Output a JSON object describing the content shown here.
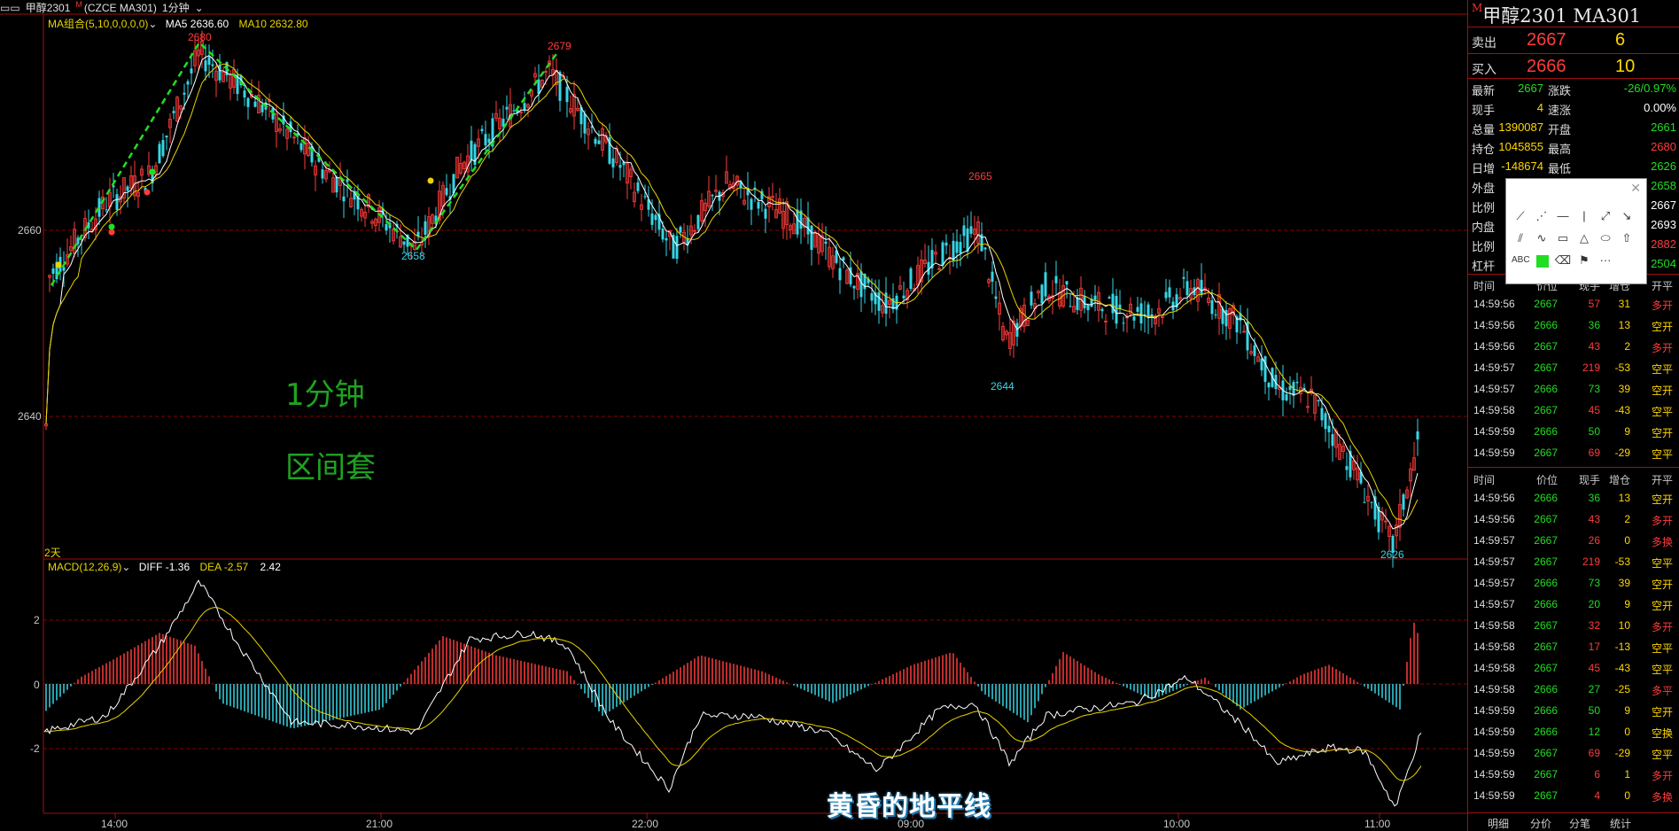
{
  "topbar": {
    "symbol": "甲醇2301",
    "code": "(CZCE MA301)",
    "period": "1分钟"
  },
  "ma_legend": {
    "name": "MA组合(5,10,0,0,0,0)",
    "ma5": "MA5 2636.60",
    "ma10": "MA10 2632.80"
  },
  "macd_legend": {
    "name": "MACD(12,26,9)",
    "diff": "DIFF -1.36",
    "dea": "DEA -2.57",
    "macd": "2.42"
  },
  "y_ticks": [
    "2660",
    "2640"
  ],
  "macd_ticks": [
    "2",
    "0",
    "-2"
  ],
  "x_ticks": [
    "14:00",
    "21:00",
    "22:00",
    "09:00",
    "10:00",
    "11:00"
  ],
  "days_label": "2天",
  "peaks": {
    "p2680": "2680",
    "p2679": "2679",
    "p2658": "2658",
    "p2665": "2665",
    "p2644": "2644",
    "p2626": "2626"
  },
  "overlay": {
    "line1": "1分钟",
    "line2": "区间套",
    "watermark": "黄昏的地平线"
  },
  "colors": {
    "up": "#ff3b3b",
    "down": "#36d6e6",
    "ma5": "#ffffff",
    "ma10": "#e8d400",
    "zigzag": "#22dd22",
    "grid": "#8b0000"
  },
  "panel": {
    "title": "甲醇2301  MA301",
    "sell": {
      "label": "卖出",
      "price": "2667",
      "vol": "6"
    },
    "buy": {
      "label": "买入",
      "price": "2666",
      "vol": "10"
    },
    "stats": [
      {
        "l1": "最新",
        "v1": "2667",
        "l2": "涨跌",
        "v2": "-26/0.97%"
      },
      {
        "l1": "现手",
        "v1": "4",
        "l2": "速涨",
        "v2": "0.00%"
      },
      {
        "l1": "总量",
        "v1": "1390087",
        "l2": "开盘",
        "v2": "2661"
      },
      {
        "l1": "持仓",
        "v1": "1045855",
        "l2": "最高",
        "v2": "2680"
      },
      {
        "l1": "日增",
        "v1": "-148674",
        "l2": "最低",
        "v2": "2626"
      },
      {
        "l1": "外盘",
        "v1": "",
        "l2": "",
        "v2": "2658"
      },
      {
        "l1": "比例",
        "v1": "",
        "l2": "",
        "v2": "2667"
      },
      {
        "l1": "内盘",
        "v1": "",
        "l2": "",
        "v2": "2693"
      },
      {
        "l1": "比例",
        "v1": "",
        "l2": "",
        "v2": "2882"
      },
      {
        "l1": "杠杆",
        "v1": "",
        "l2": "",
        "v2": "2504"
      }
    ],
    "tick_head1": {
      "time": "时间",
      "price": "价位",
      "vol": "现手",
      "oi": "增仓",
      "type": "开平"
    },
    "ticks1": [
      {
        "time": "14:59:56",
        "price": "2667",
        "vol": "57",
        "oi": "31",
        "type": "多开"
      },
      {
        "time": "14:59:56",
        "price": "2666",
        "vol": "36",
        "oi": "13",
        "type": "空开"
      },
      {
        "time": "14:59:56",
        "price": "2667",
        "vol": "43",
        "oi": "2",
        "type": "多开"
      },
      {
        "time": "14:59:57",
        "price": "2667",
        "vol": "219",
        "oi": "-53",
        "type": "空平"
      },
      {
        "time": "14:59:57",
        "price": "2666",
        "vol": "73",
        "oi": "39",
        "type": "空开"
      },
      {
        "time": "14:59:58",
        "price": "2667",
        "vol": "45",
        "oi": "-43",
        "type": "空平"
      },
      {
        "time": "14:59:59",
        "price": "2666",
        "vol": "50",
        "oi": "9",
        "type": "空开"
      },
      {
        "time": "14:59:59",
        "price": "2667",
        "vol": "69",
        "oi": "-29",
        "type": "空平"
      }
    ],
    "tick_head2": {
      "time": "时间",
      "price": "价位",
      "vol": "现手",
      "oi": "增仓",
      "type": "开平"
    },
    "ticks2": [
      {
        "time": "14:59:56",
        "price": "2666",
        "vol": "36",
        "oi": "13",
        "type": "空开"
      },
      {
        "time": "14:59:56",
        "price": "2667",
        "vol": "43",
        "oi": "2",
        "type": "多开"
      },
      {
        "time": "14:59:57",
        "price": "2667",
        "vol": "26",
        "oi": "0",
        "type": "多换"
      },
      {
        "time": "14:59:57",
        "price": "2667",
        "vol": "219",
        "oi": "-53",
        "type": "空平"
      },
      {
        "time": "14:59:57",
        "price": "2666",
        "vol": "73",
        "oi": "39",
        "type": "空开"
      },
      {
        "time": "14:59:57",
        "price": "2666",
        "vol": "20",
        "oi": "9",
        "type": "空开"
      },
      {
        "time": "14:59:58",
        "price": "2667",
        "vol": "32",
        "oi": "10",
        "type": "多开"
      },
      {
        "time": "14:59:58",
        "price": "2667",
        "vol": "17",
        "oi": "-13",
        "type": "空平"
      },
      {
        "time": "14:59:58",
        "price": "2667",
        "vol": "45",
        "oi": "-43",
        "type": "空平"
      },
      {
        "time": "14:59:58",
        "price": "2666",
        "vol": "27",
        "oi": "-25",
        "type": "多平"
      },
      {
        "time": "14:59:59",
        "price": "2666",
        "vol": "50",
        "oi": "9",
        "type": "空开"
      },
      {
        "time": "14:59:59",
        "price": "2666",
        "vol": "12",
        "oi": "0",
        "type": "空换"
      },
      {
        "time": "14:59:59",
        "price": "2667",
        "vol": "69",
        "oi": "-29",
        "type": "空平"
      },
      {
        "time": "14:59:59",
        "price": "2667",
        "vol": "6",
        "oi": "1",
        "type": "多开"
      },
      {
        "time": "14:59:59",
        "price": "2667",
        "vol": "4",
        "oi": "0",
        "type": "多换"
      }
    ],
    "tabs": [
      "明细",
      "分价",
      "分笔",
      "统计"
    ]
  },
  "toolbox": {
    "abc": "ABC",
    "more": "···"
  }
}
